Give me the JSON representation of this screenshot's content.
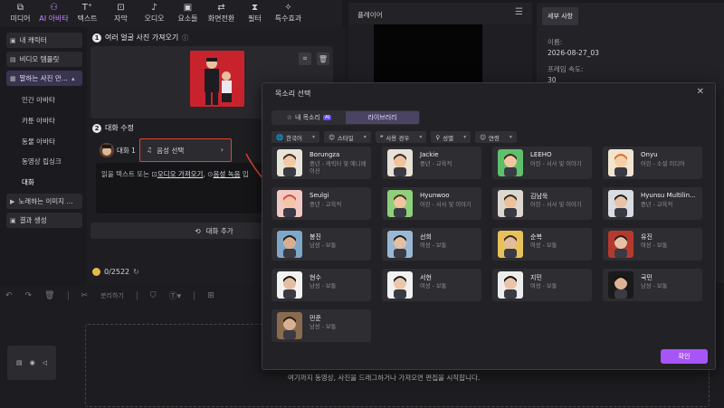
{
  "toolbar": {
    "items": [
      {
        "label": "미디어",
        "icon": "media-icon"
      },
      {
        "label": "AI 아바타",
        "icon": "ai-avatar-icon"
      },
      {
        "label": "텍스트",
        "icon": "text-icon"
      },
      {
        "label": "자막",
        "icon": "subtitle-icon"
      },
      {
        "label": "오디오",
        "icon": "audio-icon"
      },
      {
        "label": "요소들",
        "icon": "elements-icon"
      },
      {
        "label": "화면전환",
        "icon": "transition-icon"
      },
      {
        "label": "필터",
        "icon": "filter-icon"
      },
      {
        "label": "특수효과",
        "icon": "effects-icon"
      }
    ]
  },
  "sidebar": {
    "my_character": "내 캐릭터",
    "video_template": "비디오 템플릿",
    "talking_photo": "말하는 사진 만...",
    "sub_items": [
      "인간 아바타",
      "카툰 아바타",
      "동물 아바타",
      "동영상 립싱크",
      "대화"
    ],
    "singing_image": "노래하는 이미지 ...",
    "results": "결과 생성"
  },
  "steps": {
    "step1_num": "1",
    "step1_label": "여러 얼굴 사진 가져오기",
    "step2_num": "2",
    "step2_label": "대화 수정"
  },
  "dialog": {
    "speaker_label": "대화 1",
    "voice_select": "음성 선택",
    "text_prefix": "읽을 텍스트 또는",
    "audio_import": "오디오 가져오기",
    "voice_record": "음성 녹음",
    "text_suffix": "입",
    "add_dialog": "대화 추가"
  },
  "credits": {
    "value": "0/2522"
  },
  "player": {
    "title": "플레이어"
  },
  "detail": {
    "tab": "세부 사항",
    "name_label": "이름:",
    "name_value": "2026-08-27_03",
    "speed_label": "프레임 속도:",
    "speed_value": "30"
  },
  "timeline": {
    "split_label": "분리하기",
    "drop_text": "여기까지 동영상, 사진을 드래그하거나 가져오면 편집을 시작합니다."
  },
  "modal": {
    "title": "목소리 선택",
    "tab_my_voice": "내 목소리",
    "tab_my_voice_badge": "AI",
    "tab_library": "라이브러리",
    "filters": [
      {
        "label": "한국어",
        "icon": "globe-icon"
      },
      {
        "label": "스타일",
        "icon": "emoji-icon"
      },
      {
        "label": "사용 경우",
        "icon": "quote-icon"
      },
      {
        "label": "성별",
        "icon": "gender-icon"
      },
      {
        "label": "연령",
        "icon": "age-icon"
      }
    ],
    "voices": [
      {
        "name": "Borungza",
        "desc": "중년 - 캐릭터 및 애니메이션",
        "skin": "#f2c9a4",
        "hair": "#3a2b22",
        "bg": "#e9e4da"
      },
      {
        "name": "Jackie",
        "desc": "중년 - 교육적",
        "skin": "#f0c29c",
        "hair": "#2a2a2a",
        "bg": "#e8e1d6"
      },
      {
        "name": "LEEHO",
        "desc": "어린 - 서사 및 이야기",
        "skin": "#f1c6a0",
        "hair": "#3b2a1e",
        "bg": "#5fbf6a"
      },
      {
        "name": "Onyu",
        "desc": "어린 - 소셜 미디어",
        "skin": "#f6cfa8",
        "hair": "#d9702a",
        "bg": "#f3e4cf"
      },
      {
        "name": "Seulgi",
        "desc": "중년 - 교육적",
        "skin": "#f5c6a6",
        "hair": "#d8463a",
        "bg": "#f2c9c2"
      },
      {
        "name": "Hyunwoo",
        "desc": "어린 - 서사 및 이야기",
        "skin": "#f0c49d",
        "hair": "#4a3222",
        "bg": "#8fd07c"
      },
      {
        "name": "김남욱",
        "desc": "어린 - 서사 및 이야기",
        "skin": "#eec09a",
        "hair": "#2c2c2c",
        "bg": "#dcd8d0"
      },
      {
        "name": "Hyunsu Multilin...",
        "desc": "중년 - 교육적",
        "skin": "#e9c3a8",
        "hair": "#1e1e1e",
        "bg": "#d9dde2"
      },
      {
        "name": "봉진",
        "desc": "남성 - 보통",
        "skin": "#d8ae8e",
        "hair": "#1a1a1a",
        "bg": "#7fa7c8"
      },
      {
        "name": "선희",
        "desc": "여성 - 보통",
        "skin": "#e6bfa2",
        "hair": "#1d1d1d",
        "bg": "#9ab8d6"
      },
      {
        "name": "순복",
        "desc": "여성 - 보통",
        "skin": "#e3bc9c",
        "hair": "#3a2a1d",
        "bg": "#e8c15a"
      },
      {
        "name": "유진",
        "desc": "여성 - 보통",
        "skin": "#e8c1a4",
        "hair": "#2a1c16",
        "bg": "#b43a2e"
      },
      {
        "name": "현수",
        "desc": "남성 - 보통",
        "skin": "#e4bea0",
        "hair": "#151515",
        "bg": "#f2f2f2"
      },
      {
        "name": "서현",
        "desc": "여성 - 보통",
        "skin": "#ebc6aa",
        "hair": "#1b1b1b",
        "bg": "#f1f1f1"
      },
      {
        "name": "지민",
        "desc": "여성 - 보통",
        "skin": "#e9c4a6",
        "hair": "#121212",
        "bg": "#ededed"
      },
      {
        "name": "국민",
        "desc": "남성 - 보통",
        "skin": "#dcb394",
        "hair": "#111111",
        "bg": "#1a1a1a"
      },
      {
        "name": "민준",
        "desc": "남성 - 보통",
        "skin": "#d9b091",
        "hair": "#2a1e16",
        "bg": "#8a6b4e"
      }
    ],
    "confirm": "확인"
  },
  "colors": {
    "accent": "#a855f7",
    "highlight": "#e0442c"
  }
}
